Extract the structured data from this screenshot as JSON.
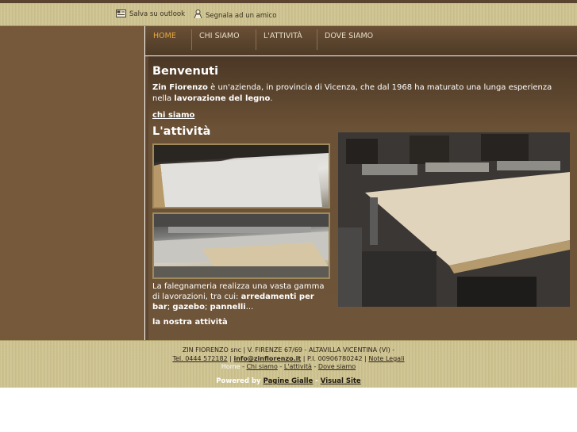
{
  "topbar": {
    "outlook_label": "Salva su outlook",
    "share_label": "Segnala ad un amico"
  },
  "nav": {
    "items": [
      {
        "label": "HOME"
      },
      {
        "label": "CHI SIAMO"
      },
      {
        "label": "L'ATTIVITÀ"
      },
      {
        "label": "DOVE SIAMO"
      }
    ]
  },
  "welcome": {
    "title": "Benvenuti",
    "company": "Zin Fiorenzo",
    "text1": " è un'azienda, in provincia di Vicenza, che dal 1968 ha maturato una lunga esperienza nella ",
    "text_bold": "lavorazione del legno",
    "text2": ".",
    "link": "chi siamo"
  },
  "activity": {
    "title": "L'attività",
    "desc_pre": "La falegnameria realizza una vasta gamma di lavorazioni, tra cui: ",
    "desc_bold1": "arredamenti per bar",
    "sep1": "; ",
    "desc_bold2": "gazebo",
    "sep2": "; ",
    "desc_bold3": "pannelli",
    "ellipsis": "...",
    "link": "la nostra attività"
  },
  "footer": {
    "line1": "ZIN FIORENZO snc | V. FIRENZE 67/69 - ALTAVILLA VICENTINA (VI) -",
    "tel": "Tel. 0444 572182",
    "email": "info@zinfiorenzo.it",
    "piva": "P.I. 00906780242",
    "legal": "Note Legali",
    "nav": [
      "Home",
      "Chi siamo",
      "L'attività",
      "Dove siamo"
    ],
    "powered": "Powered by",
    "pg": "Pagine Gialle",
    "vs": "Visual Site",
    "dash": "-",
    "pipe": "|"
  }
}
